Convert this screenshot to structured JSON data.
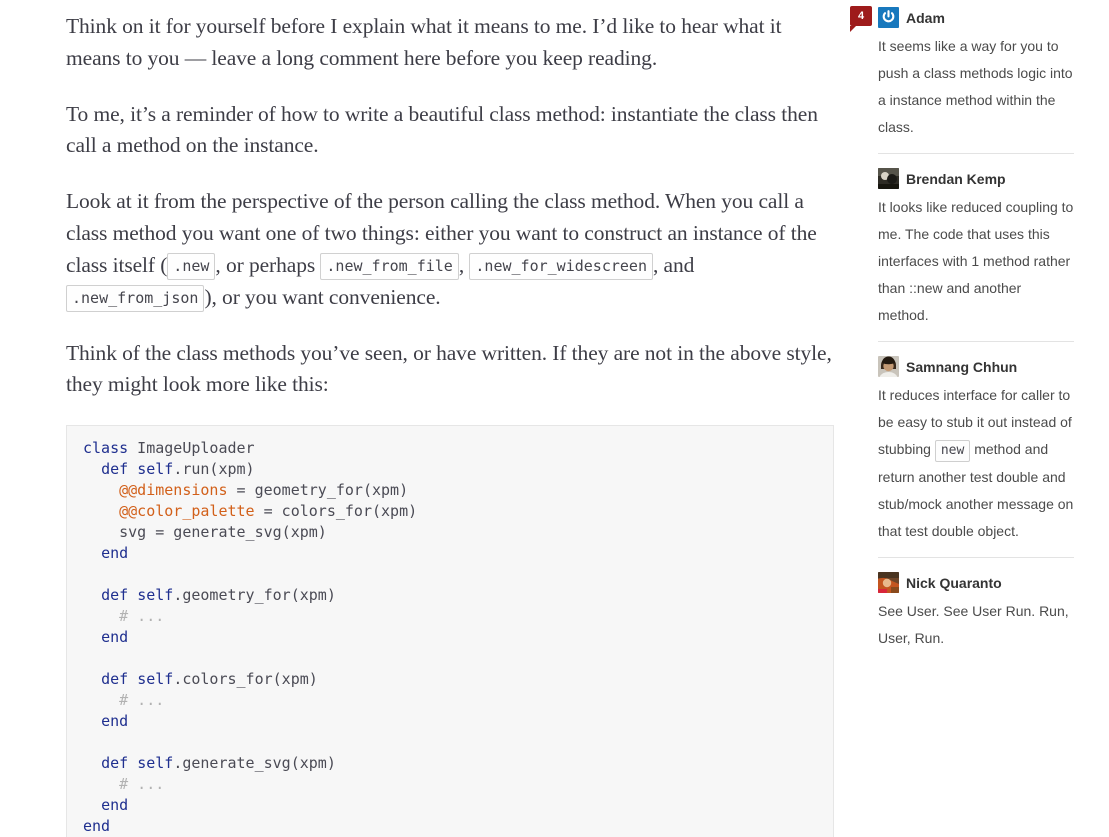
{
  "article": {
    "paragraphs": [
      {
        "id": "p1",
        "text": "Think on it for yourself before I explain what it means to me. I’d like to hear what it means to you — leave a long comment here before you keep reading."
      },
      {
        "id": "p2",
        "text": "To me, it’s a reminder of how to write a beautiful class method: instantiate the class then call a method on the instance."
      },
      {
        "id": "p3_part1",
        "text": "Look at it from the perspective of the person calling the class method. When you call a class method you want one of two things: either you want to construct an instance of the class itself ("
      },
      {
        "id": "p4",
        "text": "Think of the class methods you’ve seen, or have written. If they are not in the above style, they might look more like this:"
      }
    ],
    "p3_code_1": ".new",
    "p3_text_1": ", or perhaps",
    "p3_code_2": ".new_from_file",
    "p3_text_2": ",",
    "p3_code_3": ".new_for_widescreen",
    "p3_text_3": ", and",
    "p3_code_4": ".new_from_json",
    "p3_text_4": "), or you want convenience."
  },
  "codeblock": {
    "language": "ruby",
    "lines": [
      [
        {
          "t": "class",
          "c": "k"
        },
        {
          "t": " ImageUploader",
          "c": "pl"
        }
      ],
      [
        {
          "t": "  ",
          "c": "pl"
        },
        {
          "t": "def",
          "c": "k"
        },
        {
          "t": " ",
          "c": "pl"
        },
        {
          "t": "self",
          "c": "k"
        },
        {
          "t": ".run(xpm)",
          "c": "pl"
        }
      ],
      [
        {
          "t": "    ",
          "c": "pl"
        },
        {
          "t": "@@dimensions",
          "c": "cv"
        },
        {
          "t": " = geometry_for(xpm)",
          "c": "pl"
        }
      ],
      [
        {
          "t": "    ",
          "c": "pl"
        },
        {
          "t": "@@color_palette",
          "c": "cv"
        },
        {
          "t": " = colors_for(xpm)",
          "c": "pl"
        }
      ],
      [
        {
          "t": "    svg = generate_svg(xpm)",
          "c": "pl"
        }
      ],
      [
        {
          "t": "  ",
          "c": "pl"
        },
        {
          "t": "end",
          "c": "k"
        }
      ],
      [
        {
          "t": "",
          "c": "pl"
        }
      ],
      [
        {
          "t": "  ",
          "c": "pl"
        },
        {
          "t": "def",
          "c": "k"
        },
        {
          "t": " ",
          "c": "pl"
        },
        {
          "t": "self",
          "c": "k"
        },
        {
          "t": ".geometry_for(xpm)",
          "c": "pl"
        }
      ],
      [
        {
          "t": "    ",
          "c": "pl"
        },
        {
          "t": "# ...",
          "c": "cm"
        }
      ],
      [
        {
          "t": "  ",
          "c": "pl"
        },
        {
          "t": "end",
          "c": "k"
        }
      ],
      [
        {
          "t": "",
          "c": "pl"
        }
      ],
      [
        {
          "t": "  ",
          "c": "pl"
        },
        {
          "t": "def",
          "c": "k"
        },
        {
          "t": " ",
          "c": "pl"
        },
        {
          "t": "self",
          "c": "k"
        },
        {
          "t": ".colors_for(xpm)",
          "c": "pl"
        }
      ],
      [
        {
          "t": "    ",
          "c": "pl"
        },
        {
          "t": "# ...",
          "c": "cm"
        }
      ],
      [
        {
          "t": "  ",
          "c": "pl"
        },
        {
          "t": "end",
          "c": "k"
        }
      ],
      [
        {
          "t": "",
          "c": "pl"
        }
      ],
      [
        {
          "t": "  ",
          "c": "pl"
        },
        {
          "t": "def",
          "c": "k"
        },
        {
          "t": " ",
          "c": "pl"
        },
        {
          "t": "self",
          "c": "k"
        },
        {
          "t": ".generate_svg(xpm)",
          "c": "pl"
        }
      ],
      [
        {
          "t": "    ",
          "c": "pl"
        },
        {
          "t": "# ...",
          "c": "cm"
        }
      ],
      [
        {
          "t": "  ",
          "c": "pl"
        },
        {
          "t": "end",
          "c": "k"
        }
      ],
      [
        {
          "t": "end",
          "c": "k"
        }
      ]
    ]
  },
  "sidebar": {
    "badge_count": "4",
    "badge_color": "#9e1b1b",
    "comments": [
      {
        "author": "Adam",
        "avatar": "power-icon-avatar",
        "avatar_color": "#1878bd",
        "body": "It seems like a way for you to push a class methods logic into a instance method within the class."
      },
      {
        "author": "Brendan Kemp",
        "avatar": "photo-avatar",
        "avatar_color": "#3c3a33",
        "body": "It looks like reduced coupling to me. The code that uses this interfaces with 1 method rather than ::new and another method."
      },
      {
        "author": "Samnang Chhun",
        "avatar": "photo-avatar",
        "avatar_color": "#8a6a52",
        "body_before": "It reduces interface for caller to be easy to stub it out instead of stubbing",
        "body_code": "new",
        "body_after": "method and return another test double and stub/mock another message on that test double object."
      },
      {
        "author": "Nick Quaranto",
        "avatar": "photo-avatar",
        "avatar_color": "#b8452a",
        "body": "See User. See User Run. Run, User, Run."
      }
    ]
  }
}
